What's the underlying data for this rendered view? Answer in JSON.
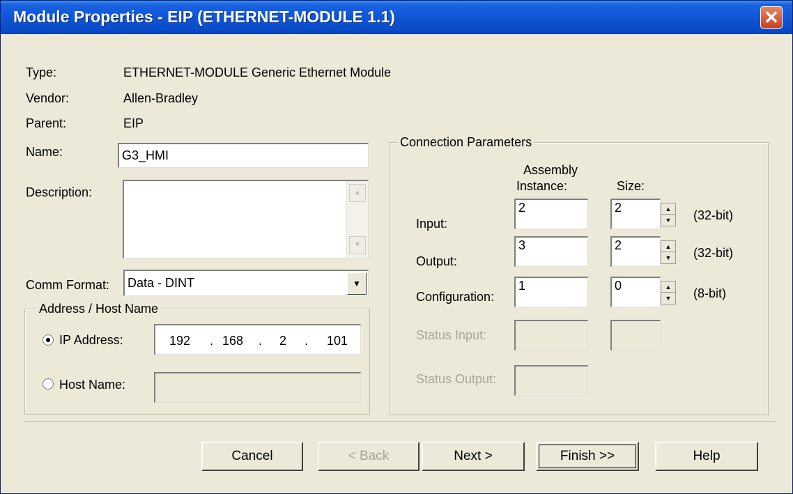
{
  "window": {
    "title": "Module Properties - EIP (ETHERNET-MODULE 1.1)"
  },
  "info": {
    "type_label": "Type:",
    "type_value": "ETHERNET-MODULE Generic Ethernet Module",
    "vendor_label": "Vendor:",
    "vendor_value": "Allen-Bradley",
    "parent_label": "Parent:",
    "parent_value": "EIP"
  },
  "name": {
    "label": "Name:",
    "value": "G3_HMI"
  },
  "description": {
    "label": "Description:",
    "value": ""
  },
  "comm_format": {
    "label": "Comm Format:",
    "value": "Data - DINT"
  },
  "address": {
    "legend": "Address / Host Name",
    "ip_label": "IP Address:",
    "ip": [
      "192",
      "168",
      "2",
      "101"
    ],
    "host_label": "Host Name:",
    "host_value": ""
  },
  "connection": {
    "legend": "Connection Parameters",
    "col_instance_l1": "Assembly",
    "col_instance_l2": "Instance:",
    "col_size": "Size:",
    "rows": [
      {
        "label": "Input:",
        "instance": "2",
        "size": "2",
        "unit": "(32-bit)"
      },
      {
        "label": "Output:",
        "instance": "3",
        "size": "2",
        "unit": "(32-bit)"
      },
      {
        "label": "Configuration:",
        "instance": "1",
        "size": "0",
        "unit": "(8-bit)"
      }
    ],
    "status_input_label": "Status Input:",
    "status_output_label": "Status Output:"
  },
  "buttons": {
    "cancel": "Cancel",
    "back": "< Back",
    "next": "Next >",
    "finish": "Finish >>",
    "help": "Help"
  }
}
